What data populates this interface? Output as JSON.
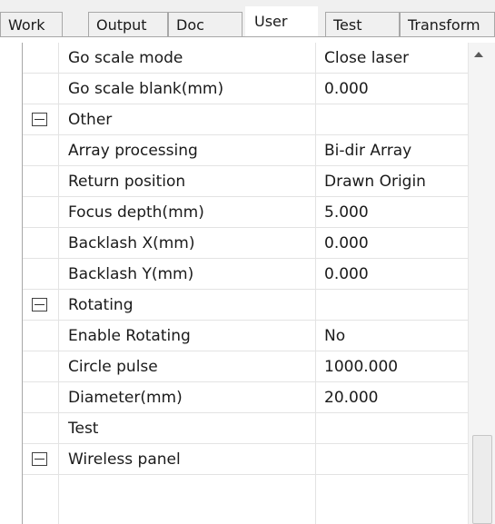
{
  "tabs": [
    {
      "label": "Work"
    },
    {
      "label": "Output"
    },
    {
      "label": "Doc"
    },
    {
      "label": "User",
      "active": true
    },
    {
      "label": "Test"
    },
    {
      "label": "Transform"
    }
  ],
  "rows": [
    {
      "name": "Go scale mode",
      "value": "Close laser"
    },
    {
      "name": "Go scale blank(mm)",
      "value": "0.000"
    },
    {
      "name": "Other",
      "value": "",
      "group": true
    },
    {
      "name": "Array processing",
      "value": "Bi-dir Array"
    },
    {
      "name": "Return position",
      "value": "Drawn Origin"
    },
    {
      "name": "Focus depth(mm)",
      "value": "5.000"
    },
    {
      "name": "Backlash X(mm)",
      "value": "0.000"
    },
    {
      "name": "Backlash Y(mm)",
      "value": "0.000"
    },
    {
      "name": "Rotating",
      "value": "",
      "group": true
    },
    {
      "name": "Enable Rotating",
      "value": "No"
    },
    {
      "name": "Circle pulse",
      "value": "1000.000"
    },
    {
      "name": "Diameter(mm)",
      "value": "20.000"
    },
    {
      "name": "Test",
      "value": ""
    },
    {
      "name": "Wireless panel",
      "value": "",
      "group": true
    }
  ]
}
